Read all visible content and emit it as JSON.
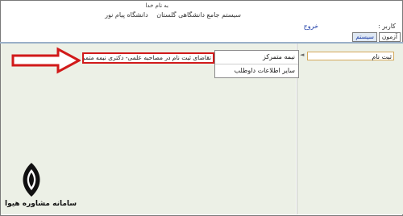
{
  "header": {
    "bismillah": "به نام خدا",
    "system_title": "سیستم جامع دانشگاهی گلستان",
    "university": "دانشگاه پیام نور"
  },
  "userbar": {
    "user_label": "کاربر :",
    "logout_label": "خروج"
  },
  "tabs": [
    {
      "label": "آزمون"
    },
    {
      "label": "سیستم"
    }
  ],
  "sidebar": {
    "register_label": "ثبت نام"
  },
  "menu": {
    "items": [
      {
        "label": "نیمه متمرکز"
      },
      {
        "label": "سایر اطلاعات داوطلب"
      }
    ]
  },
  "submenu": {
    "highlight_label": "تقاضای ثبت نام در مصاحبه علمی- دکتری نیمه متمرکز"
  },
  "watermark": {
    "text": "سامانه مشاوره هیوا"
  },
  "colors": {
    "panel_bg": "#ecf0e6",
    "highlight_red": "#d11a1a",
    "link_blue": "#1f3fa8"
  }
}
